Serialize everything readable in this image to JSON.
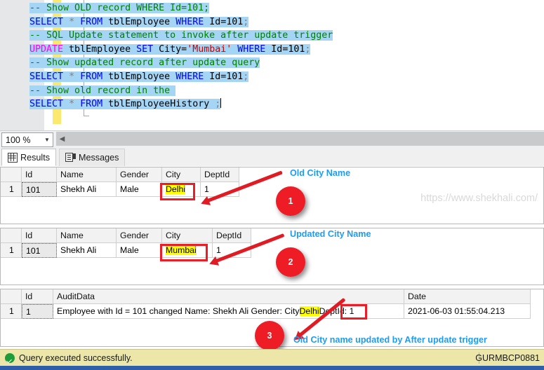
{
  "editor": {
    "lines": [
      {
        "segments": [
          {
            "t": "-- Show OLD record WHERE Id=101;",
            "c": "t-com"
          }
        ]
      },
      {
        "segments": [
          {
            "t": "SELECT",
            "c": "t-kw"
          },
          {
            "t": " ",
            "c": "t-txt"
          },
          {
            "t": "*",
            "c": "t-op"
          },
          {
            "t": " ",
            "c": "t-txt"
          },
          {
            "t": "FROM",
            "c": "t-kw"
          },
          {
            "t": " tblEmployee ",
            "c": "t-txt"
          },
          {
            "t": "WHERE",
            "c": "t-kw"
          },
          {
            "t": " Id=101",
            "c": "t-txt"
          },
          {
            "t": ";",
            "c": "t-op"
          }
        ]
      },
      {
        "segments": [
          {
            "t": "-- SQL Update statement to invoke after update trigger",
            "c": "t-com"
          }
        ]
      },
      {
        "segments": [
          {
            "t": "UPDATE",
            "c": "t-upd"
          },
          {
            "t": " tblEmployee ",
            "c": "t-txt"
          },
          {
            "t": "SET",
            "c": "t-kw"
          },
          {
            "t": " City=",
            "c": "t-txt"
          },
          {
            "t": "'Mumbai'",
            "c": "t-str"
          },
          {
            "t": " ",
            "c": "t-txt"
          },
          {
            "t": "WHERE",
            "c": "t-kw"
          },
          {
            "t": " Id=101",
            "c": "t-txt"
          },
          {
            "t": ";",
            "c": "t-op"
          }
        ]
      },
      {
        "segments": [
          {
            "t": "-- Show updated record after update query",
            "c": "t-com"
          }
        ]
      },
      {
        "segments": [
          {
            "t": "SELECT",
            "c": "t-kw"
          },
          {
            "t": " ",
            "c": "t-txt"
          },
          {
            "t": "*",
            "c": "t-op"
          },
          {
            "t": " ",
            "c": "t-txt"
          },
          {
            "t": "FROM",
            "c": "t-kw"
          },
          {
            "t": " tblEmployee ",
            "c": "t-txt"
          },
          {
            "t": "WHERE",
            "c": "t-kw"
          },
          {
            "t": " Id=101",
            "c": "t-txt"
          },
          {
            "t": ";",
            "c": "t-op"
          }
        ]
      },
      {
        "segments": [
          {
            "t": "-- Show old record in the ",
            "c": "t-com"
          }
        ]
      },
      {
        "segments": [
          {
            "t": "SELECT",
            "c": "t-kw"
          },
          {
            "t": " ",
            "c": "t-txt"
          },
          {
            "t": "*",
            "c": "t-op"
          },
          {
            "t": " ",
            "c": "t-txt"
          },
          {
            "t": "FROM",
            "c": "t-kw"
          },
          {
            "t": " tblEmployeeHistory ",
            "c": "t-txt"
          },
          {
            "t": ";",
            "c": "t-op"
          }
        ]
      }
    ]
  },
  "zoom": {
    "value": "100 %",
    "arrow": "▼"
  },
  "tabs": [
    {
      "label": "Results",
      "icon": "grid-icon",
      "active": true
    },
    {
      "label": "Messages",
      "icon": "messages-icon",
      "active": false
    }
  ],
  "grid1": {
    "columns": [
      "",
      "Id",
      "Name",
      "Gender",
      "City",
      "DeptId"
    ],
    "rows": [
      [
        "1",
        "101",
        "Shekh Ali",
        "Male",
        "Delhi",
        "1"
      ]
    ]
  },
  "grid2": {
    "columns": [
      "",
      "Id",
      "Name",
      "Gender",
      "City",
      "DeptId"
    ],
    "rows": [
      [
        "1",
        "101",
        "Shekh Ali",
        "Male",
        "Mumbai",
        "1"
      ]
    ]
  },
  "grid3": {
    "columns": [
      "",
      "Id",
      "AuditData",
      "Date"
    ],
    "rows": [
      [
        "1",
        "1",
        {
          "pre": "Employee with Id = 101 changed Name: Shekh Ali Gender:  City",
          "hl": "Delhi",
          "post": "DeptId: 1"
        },
        "2021-06-03 01:55:04.213"
      ]
    ]
  },
  "annotations": {
    "label1": "Old City Name",
    "label2": "Updated City Name",
    "label3": "Old City name updated by After update trigger",
    "badge1": "1",
    "badge2": "2",
    "badge3": "3",
    "accent": "#1e9cf0",
    "marker": "#ee1c25",
    "highlight": "#ffff00"
  },
  "watermark": "https://www.shekhali.com/",
  "status": {
    "message": "Query executed successfully.",
    "server": "GURMBCP0881",
    "icon": "success-check-icon"
  }
}
